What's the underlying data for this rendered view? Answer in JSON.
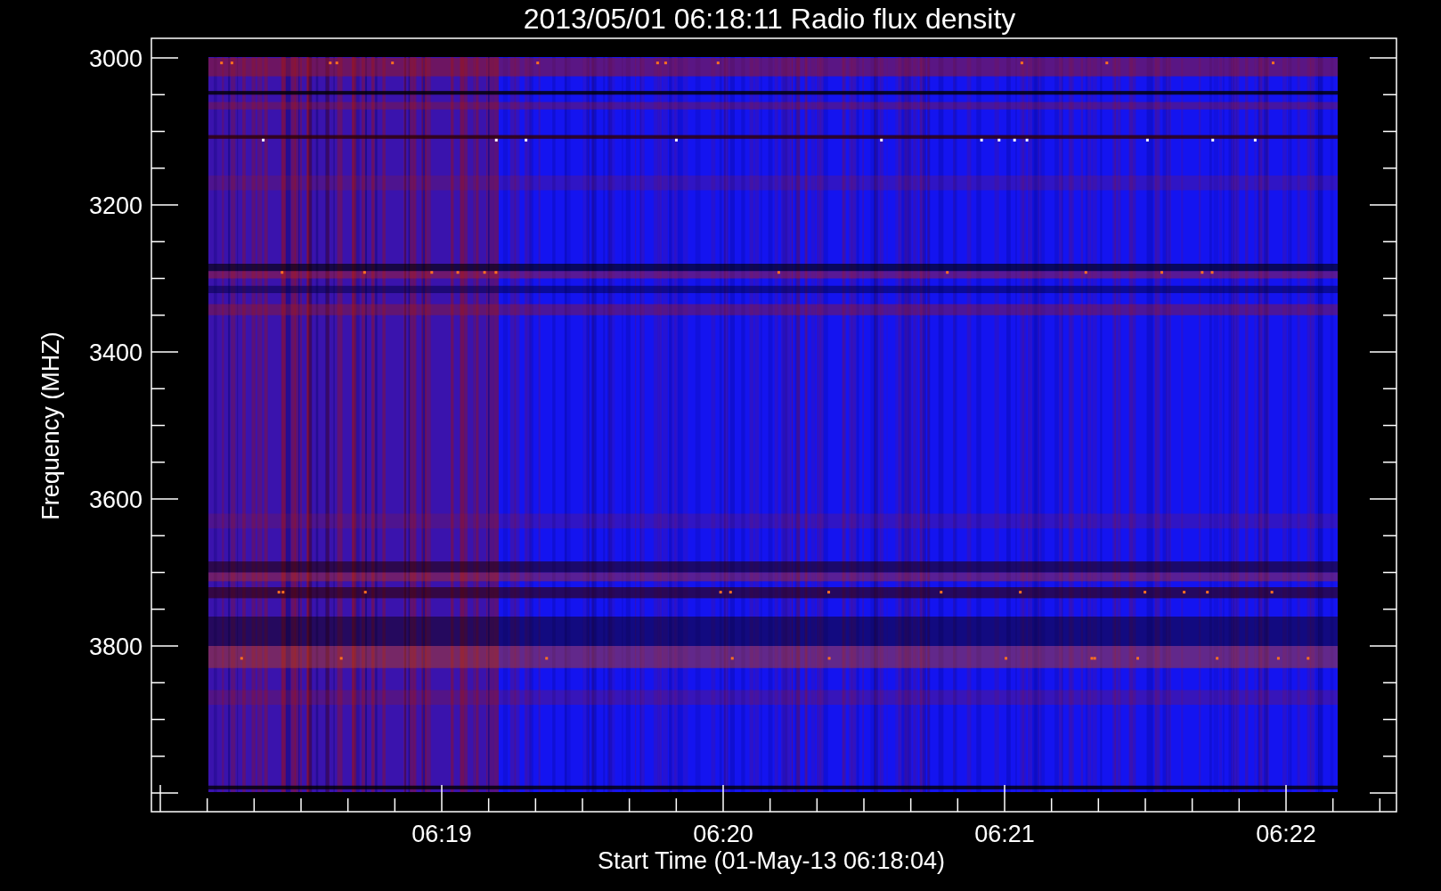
{
  "title": "2013/05/01 06:18:11 Radio flux density",
  "xlabel": "Start Time (01-May-13 06:18:04)",
  "ylabel": "Frequency (MHZ)",
  "xtick_labels": [
    "06:19",
    "06:20",
    "06:21",
    "06:22"
  ],
  "ytick_labels": [
    "3000",
    "3200",
    "3400",
    "3600",
    "3800"
  ]
}
